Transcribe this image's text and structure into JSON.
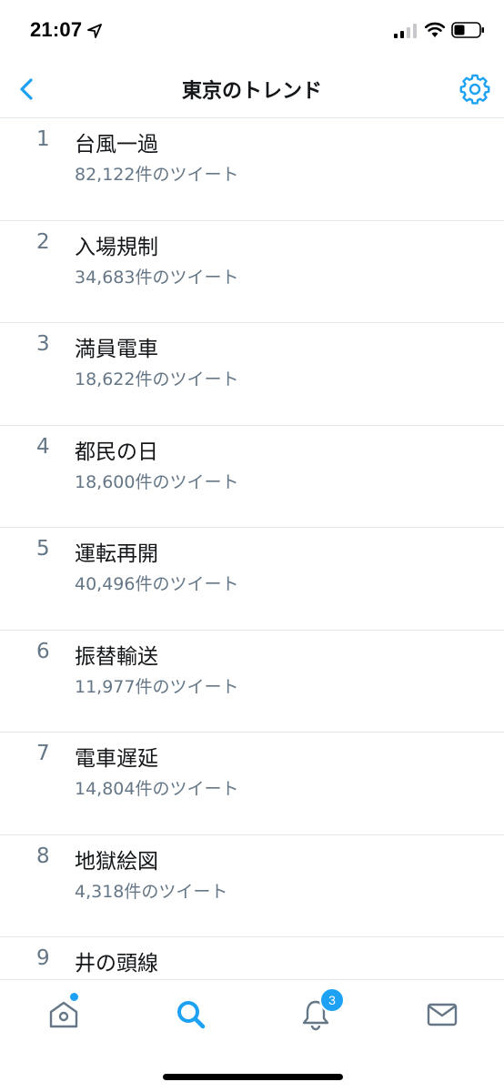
{
  "status_bar": {
    "time": "21:07"
  },
  "nav": {
    "title": "東京のトレンド"
  },
  "trends": [
    {
      "rank": "1",
      "name": "台風一過",
      "count": "82,122件のツイート"
    },
    {
      "rank": "2",
      "name": "入場規制",
      "count": "34,683件のツイート"
    },
    {
      "rank": "3",
      "name": "満員電車",
      "count": "18,622件のツイート"
    },
    {
      "rank": "4",
      "name": "都民の日",
      "count": "18,600件のツイート"
    },
    {
      "rank": "5",
      "name": "運転再開",
      "count": "40,496件のツイート"
    },
    {
      "rank": "6",
      "name": "振替輸送",
      "count": "11,977件のツイート"
    },
    {
      "rank": "7",
      "name": "電車遅延",
      "count": "14,804件のツイート"
    },
    {
      "rank": "8",
      "name": "地獄絵図",
      "count": "4,318件のツイート"
    },
    {
      "rank": "9",
      "name": "井の頭線",
      "count": ""
    }
  ],
  "tab_bar": {
    "notifications_badge": "3",
    "icons": [
      "home-icon",
      "search-icon",
      "bell-icon",
      "mail-icon"
    ]
  },
  "colors": {
    "accent": "#1da1f2",
    "secondary_text": "#657786",
    "divider": "#e1e8ed"
  }
}
